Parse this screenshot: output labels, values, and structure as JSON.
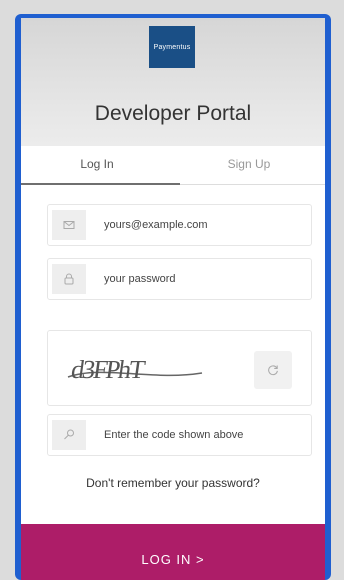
{
  "header": {
    "logo_text": "Paymentus",
    "title": "Developer Portal"
  },
  "tabs": [
    {
      "label": "Log In",
      "active": true
    },
    {
      "label": "Sign Up",
      "active": false
    }
  ],
  "email": {
    "placeholder": "yours@example.com",
    "icon": "envelope-icon"
  },
  "password": {
    "placeholder": "your password",
    "icon": "lock-icon"
  },
  "captcha": {
    "text": "d3FPhT",
    "refresh_icon": "refresh-icon"
  },
  "code": {
    "placeholder": "Enter the code shown above",
    "icon": "key-icon"
  },
  "forgot_password": "Don't remember your password?",
  "login_button": "LOG IN >",
  "colors": {
    "frame": "#1f5fd0",
    "logo": "#1a4f86",
    "primary": "#ad1d68"
  }
}
